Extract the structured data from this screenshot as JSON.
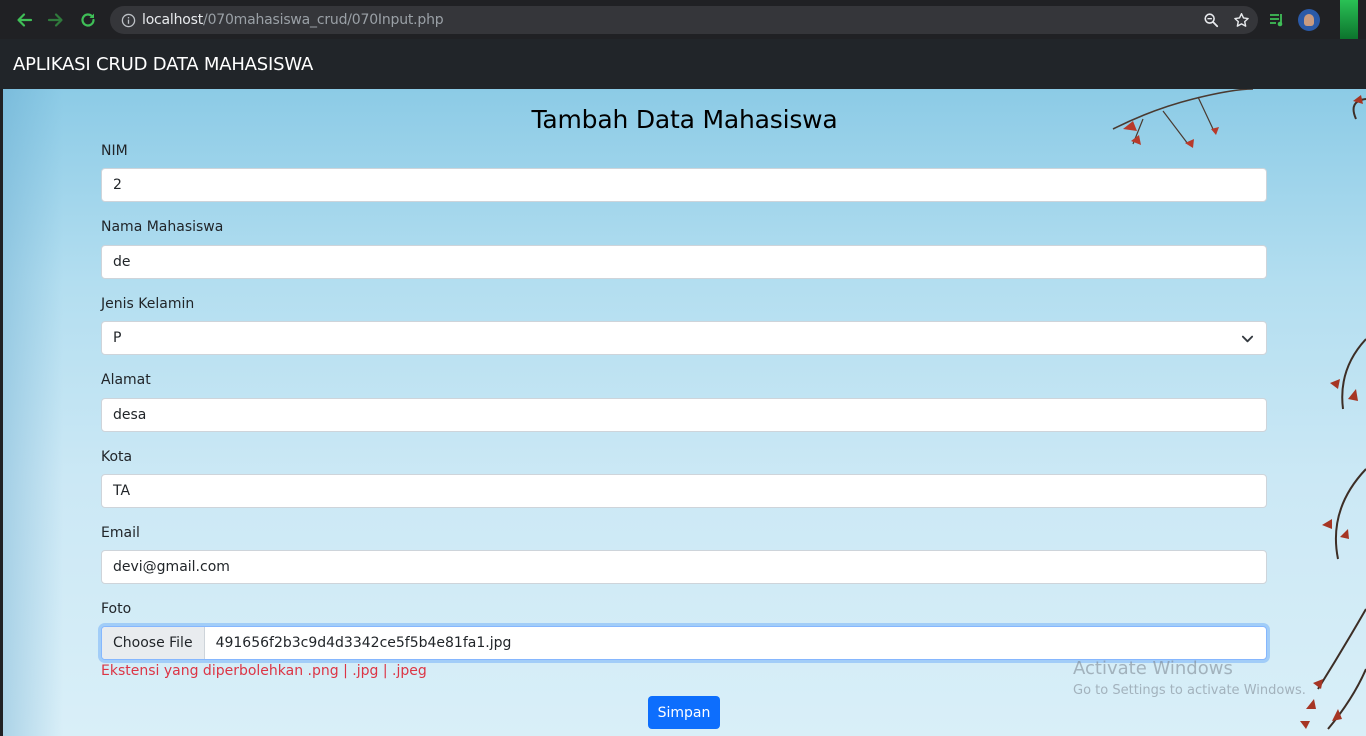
{
  "browser": {
    "url_host": "localhost",
    "url_path": "/070mahasiswa_crud/070Input.php"
  },
  "navbar": {
    "brand": "APLIKASI CRUD DATA MAHASISWA"
  },
  "form": {
    "title": "Tambah Data Mahasiswa",
    "nim": {
      "label": "NIM",
      "value": "2"
    },
    "nama": {
      "label": "Nama Mahasiswa",
      "value": "de"
    },
    "jenis_kelamin": {
      "label": "Jenis Kelamin",
      "value": "P"
    },
    "alamat": {
      "label": "Alamat",
      "value": "desa"
    },
    "kota": {
      "label": "Kota",
      "value": "TA"
    },
    "email": {
      "label": "Email",
      "value": "devi@gmail.com"
    },
    "foto": {
      "label": "Foto",
      "button": "Choose File",
      "filename": "491656f2b3c9d4d3342ce5f5b4e81fa1.jpg"
    },
    "hint": "Ekstensi yang diperbolehkan .png | .jpg | .jpeg",
    "submit": "Simpan"
  },
  "watermark": {
    "line1": "Activate Windows",
    "line2": "Go to Settings to activate Windows."
  },
  "colors": {
    "primary": "#0d6efd",
    "danger": "#dc3545",
    "navbar": "#212529",
    "chrome": "#202124"
  }
}
